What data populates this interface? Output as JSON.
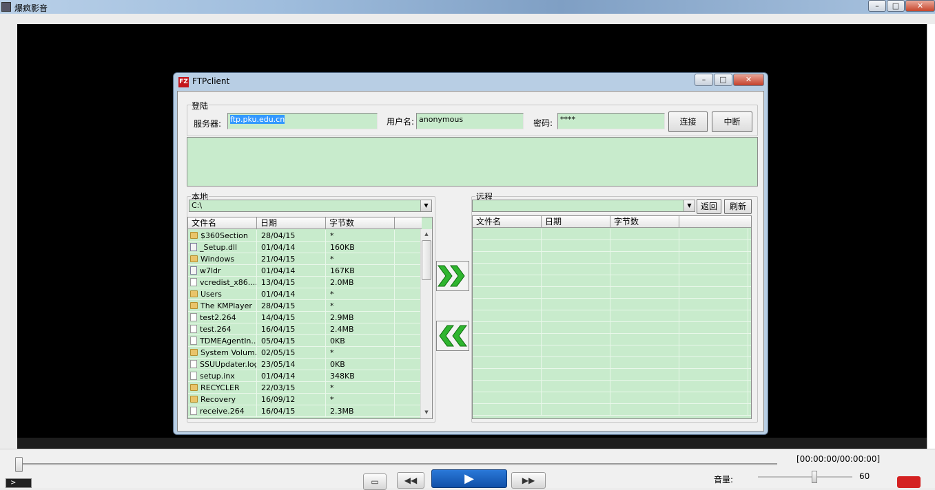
{
  "player": {
    "title": "爆疯影音",
    "time": "[00:00:00/00:00:00]",
    "volume_label": "音量:",
    "volume_value": "60",
    "volume_level": 0.6,
    "seek_position": 0,
    "menu_symbol": ">",
    "buttons": {
      "minimize": "–",
      "maximize": "□",
      "close": "✕",
      "fullscreen": "▭",
      "prev": "◀◀",
      "play": "▶",
      "next": "▶▶"
    }
  },
  "ftp": {
    "title": "FTPclient",
    "icon_text": "FZ",
    "caption_buttons": {
      "minimize": "–",
      "maximize": "□",
      "close": "✕"
    },
    "login": {
      "group_label": "登陆",
      "server_label": "服务器:",
      "server_value": "ftp.pku.edu.cn",
      "user_label": "用户名:",
      "user_value": "anonymous",
      "password_label": "密码:",
      "password_value": "****",
      "connect_button": "连接",
      "disconnect_button": "中断"
    },
    "local": {
      "group_label": "本地",
      "path": "C:\\",
      "columns": [
        "文件名",
        "日期",
        "字节数"
      ],
      "files": [
        {
          "icon": "folder-icon",
          "name": "$360Section",
          "date": "28/04/15",
          "size": "*"
        },
        {
          "icon": "system-file-icon",
          "name": "_Setup.dll",
          "date": "01/04/14",
          "size": "160KB"
        },
        {
          "icon": "folder-icon",
          "name": "Windows",
          "date": "21/04/15",
          "size": "*"
        },
        {
          "icon": "system-file-icon",
          "name": "w7ldr",
          "date": "01/04/14",
          "size": "167KB"
        },
        {
          "icon": "file-icon",
          "name": "vcredist_x86....",
          "date": "13/04/15",
          "size": "2.0MB"
        },
        {
          "icon": "folder-icon",
          "name": "Users",
          "date": "01/04/14",
          "size": "*"
        },
        {
          "icon": "folder-icon",
          "name": "The KMPlayer",
          "date": "28/04/15",
          "size": "*"
        },
        {
          "icon": "file-icon",
          "name": "test2.264",
          "date": "14/04/15",
          "size": "2.9MB"
        },
        {
          "icon": "file-icon",
          "name": "test.264",
          "date": "16/04/15",
          "size": "2.4MB"
        },
        {
          "icon": "file-icon",
          "name": "TDMEAgentIn...",
          "date": "05/04/15",
          "size": "0KB"
        },
        {
          "icon": "folder-icon",
          "name": "System Volum...",
          "date": "02/05/15",
          "size": "*"
        },
        {
          "icon": "file-icon",
          "name": "SSUUpdater.log",
          "date": "23/05/14",
          "size": "0KB"
        },
        {
          "icon": "file-icon",
          "name": "setup.inx",
          "date": "01/04/14",
          "size": "348KB"
        },
        {
          "icon": "folder-icon",
          "name": "RECYCLER",
          "date": "22/03/15",
          "size": "*"
        },
        {
          "icon": "folder-icon",
          "name": "Recovery",
          "date": "16/09/12",
          "size": "*"
        },
        {
          "icon": "file-icon",
          "name": "receive.264",
          "date": "16/04/15",
          "size": "2.3MB"
        }
      ]
    },
    "remote": {
      "group_label": "远程",
      "path": "",
      "back_button": "返回",
      "refresh_button": "刷新",
      "columns": [
        "文件名",
        "日期",
        "字节数"
      ]
    },
    "accent_green": "#c8ebcc",
    "arrow_green": "#2fb52f"
  }
}
